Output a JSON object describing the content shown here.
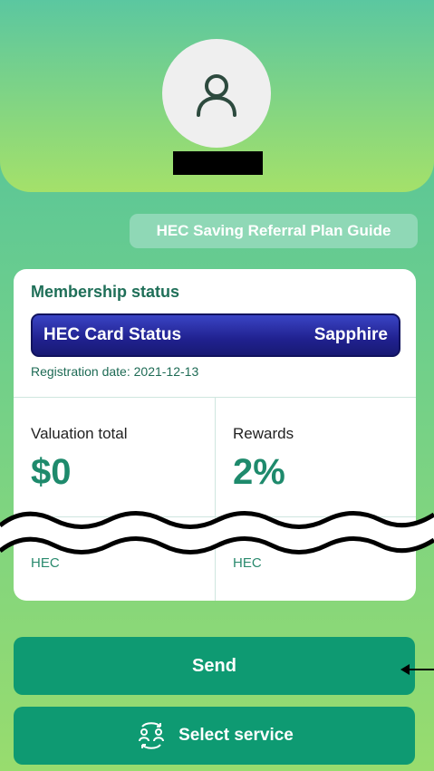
{
  "profile": {
    "avatar_icon": "user-icon"
  },
  "guide_button": {
    "label": "HEC Saving Referral Plan Guide"
  },
  "membership": {
    "title": "Membership status",
    "card_status_label": "HEC Card Status",
    "card_status_value": "Sapphire",
    "registration": "Registration date: 2021-12-13",
    "valuation_label": "Valuation total",
    "valuation_value": "$0",
    "rewards_label": "Rewards",
    "rewards_value": "2%",
    "left_unit": "HEC",
    "right_unit": "HEC"
  },
  "actions": {
    "send_label": "Send",
    "select_service_label": "Select service",
    "select_service_icon": "people-exchange-icon"
  },
  "colors": {
    "primary": "#0e9a72",
    "accent_text": "#1e8a6c",
    "status_bar": "#20218f"
  }
}
